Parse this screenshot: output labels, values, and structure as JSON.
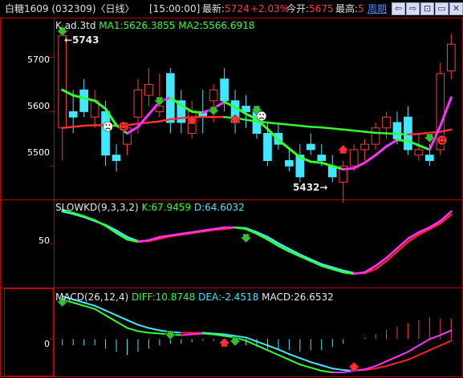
{
  "header": {
    "stock_name": "白糖1609 (032309)〈日线〉",
    "time": "[15:00:00]",
    "latest_label": "最新:",
    "latest_value": "5724",
    "change": "+2.03%",
    "open_label": "今开:",
    "open_value": "5675",
    "high_label": "最高:",
    "high_value": "5",
    "period_link": "周期",
    "buttons": [
      "⇦",
      "⇨",
      "⊡",
      "▭",
      "✕"
    ]
  },
  "kline_panel": {
    "code_label": "K",
    "ad_label": "ad.3td",
    "ma1_text": "MA1:5626.3855",
    "ma2_text": "MA2:5566.6918",
    "high_annotation": "←5743",
    "low_annotation": "5432→",
    "y_ticks": [
      "5700",
      "5600",
      "5500"
    ],
    "y_tick_values": [
      5700,
      5600,
      5500
    ],
    "range": [
      5440,
      5770
    ]
  },
  "slowkd_panel": {
    "name": "SLOWKD(9,3,3,2)",
    "k_text": "K:67.9459",
    "d_text": "D:64.6032",
    "y_ticks": [
      "50"
    ],
    "range": [
      0,
      100
    ],
    "k_values": [
      92,
      88,
      84,
      79,
      72,
      63,
      55,
      52,
      54,
      58,
      60,
      62,
      64,
      66,
      68,
      70,
      70,
      68,
      62,
      55,
      47,
      40,
      34,
      28,
      22,
      18,
      14,
      12,
      14,
      22,
      32,
      44,
      56,
      64,
      70,
      78,
      90
    ],
    "d_values": [
      90,
      87,
      83,
      78,
      73,
      66,
      58,
      53,
      53,
      56,
      59,
      61,
      63,
      65,
      67,
      68,
      70,
      69,
      64,
      58,
      50,
      43,
      36,
      30,
      24,
      20,
      16,
      13,
      13,
      18,
      28,
      40,
      52,
      61,
      68,
      75,
      86
    ]
  },
  "macd_panel": {
    "name": "MACD(26,12,4)",
    "diff_text": "DIFF:10.8748",
    "dea_text": "DEA:-2.4518",
    "macd_text": "MACD:26.6532",
    "y_ticks": [
      "0"
    ],
    "range": [
      -45,
      60
    ],
    "diff_values": [
      50,
      46,
      42,
      38,
      30,
      22,
      14,
      10,
      8,
      7,
      6,
      5,
      6,
      7,
      6,
      4,
      2,
      -2,
      -8,
      -14,
      -20,
      -26,
      -32,
      -36,
      -40,
      -42,
      -42,
      -40,
      -38,
      -34,
      -28,
      -22,
      -16,
      -8,
      0,
      5,
      11
    ],
    "dea_values": [
      54,
      50,
      46,
      42,
      36,
      30,
      24,
      18,
      14,
      11,
      9,
      8,
      8,
      8,
      7,
      6,
      4,
      2,
      -3,
      -8,
      -13,
      -19,
      -24,
      -29,
      -33,
      -37,
      -39,
      -40,
      -39,
      -37,
      -34,
      -30,
      -26,
      -20,
      -14,
      -8,
      -2
    ]
  },
  "candles": [
    {
      "o": 5570,
      "h": 5760,
      "l": 5510,
      "c": 5740
    },
    {
      "o": 5600,
      "h": 5640,
      "l": 5560,
      "c": 5590
    },
    {
      "o": 5640,
      "h": 5660,
      "l": 5590,
      "c": 5600
    },
    {
      "o": 5590,
      "h": 5640,
      "l": 5570,
      "c": 5620
    },
    {
      "o": 5600,
      "h": 5620,
      "l": 5500,
      "c": 5520
    },
    {
      "o": 5520,
      "h": 5540,
      "l": 5490,
      "c": 5510
    },
    {
      "o": 5540,
      "h": 5580,
      "l": 5520,
      "c": 5570
    },
    {
      "o": 5590,
      "h": 5660,
      "l": 5560,
      "c": 5640
    },
    {
      "o": 5630,
      "h": 5680,
      "l": 5610,
      "c": 5650
    },
    {
      "o": 5600,
      "h": 5670,
      "l": 5590,
      "c": 5610
    },
    {
      "o": 5670,
      "h": 5680,
      "l": 5560,
      "c": 5580
    },
    {
      "o": 5620,
      "h": 5640,
      "l": 5560,
      "c": 5580
    },
    {
      "o": 5560,
      "h": 5620,
      "l": 5550,
      "c": 5600
    },
    {
      "o": 5600,
      "h": 5640,
      "l": 5560,
      "c": 5590
    },
    {
      "o": 5620,
      "h": 5650,
      "l": 5580,
      "c": 5640
    },
    {
      "o": 5660,
      "h": 5680,
      "l": 5600,
      "c": 5620
    },
    {
      "o": 5620,
      "h": 5640,
      "l": 5560,
      "c": 5580
    },
    {
      "o": 5610,
      "h": 5630,
      "l": 5570,
      "c": 5600
    },
    {
      "o": 5600,
      "h": 5610,
      "l": 5550,
      "c": 5560
    },
    {
      "o": 5560,
      "h": 5580,
      "l": 5500,
      "c": 5510
    },
    {
      "o": 5560,
      "h": 5580,
      "l": 5530,
      "c": 5540
    },
    {
      "o": 5510,
      "h": 5530,
      "l": 5490,
      "c": 5500
    },
    {
      "o": 5520,
      "h": 5540,
      "l": 5470,
      "c": 5480
    },
    {
      "o": 5540,
      "h": 5560,
      "l": 5520,
      "c": 5530
    },
    {
      "o": 5520,
      "h": 5540,
      "l": 5500,
      "c": 5510
    },
    {
      "o": 5500,
      "h": 5520,
      "l": 5470,
      "c": 5480
    },
    {
      "o": 5470,
      "h": 5510,
      "l": 5432,
      "c": 5500
    },
    {
      "o": 5500,
      "h": 5540,
      "l": 5490,
      "c": 5530
    },
    {
      "o": 5530,
      "h": 5550,
      "l": 5510,
      "c": 5540
    },
    {
      "o": 5540,
      "h": 5580,
      "l": 5530,
      "c": 5570
    },
    {
      "o": 5570,
      "h": 5600,
      "l": 5550,
      "c": 5590
    },
    {
      "o": 5580,
      "h": 5600,
      "l": 5540,
      "c": 5550
    },
    {
      "o": 5590,
      "h": 5610,
      "l": 5520,
      "c": 5530
    },
    {
      "o": 5520,
      "h": 5560,
      "l": 5510,
      "c": 5530
    },
    {
      "o": 5520,
      "h": 5540,
      "l": 5500,
      "c": 5510
    },
    {
      "o": 5530,
      "h": 5690,
      "l": 5520,
      "c": 5670
    },
    {
      "o": 5675,
      "h": 5743,
      "l": 5660,
      "c": 5724
    }
  ],
  "ma1": [
    5640,
    5630,
    5625,
    5620,
    5605,
    5575,
    5560,
    5572,
    5595,
    5618,
    5626,
    5612,
    5600,
    5598,
    5606,
    5618,
    5608,
    5596,
    5586,
    5568,
    5548,
    5532,
    5516,
    5508,
    5506,
    5500,
    5494,
    5496,
    5506,
    5520,
    5536,
    5548,
    5546,
    5538,
    5530,
    5574,
    5626
  ],
  "ma2": [
    5570,
    5572,
    5574,
    5575,
    5575,
    5574,
    5575,
    5578,
    5580,
    5582,
    5586,
    5588,
    5590,
    5590,
    5590,
    5590,
    5588,
    5585,
    5582,
    5580,
    5578,
    5576,
    5574,
    5572,
    5571,
    5569,
    5567,
    5565,
    5563,
    5561,
    5560,
    5559,
    5558,
    5559,
    5561,
    5563,
    5567
  ],
  "colors": {
    "up": "#ff3c3c",
    "down": "#40e8ff",
    "ma1_up": "#ff30ff",
    "ma1_down": "#30ff30",
    "ma2_up": "#ff3030",
    "ma2_down": "#30ff30",
    "kd_k_up": "#ff30ff",
    "kd_k_down": "#30ff30",
    "kd_d_up": "#ff2020",
    "kd_d_down": "#40e8ff",
    "frame": "#c00000"
  }
}
